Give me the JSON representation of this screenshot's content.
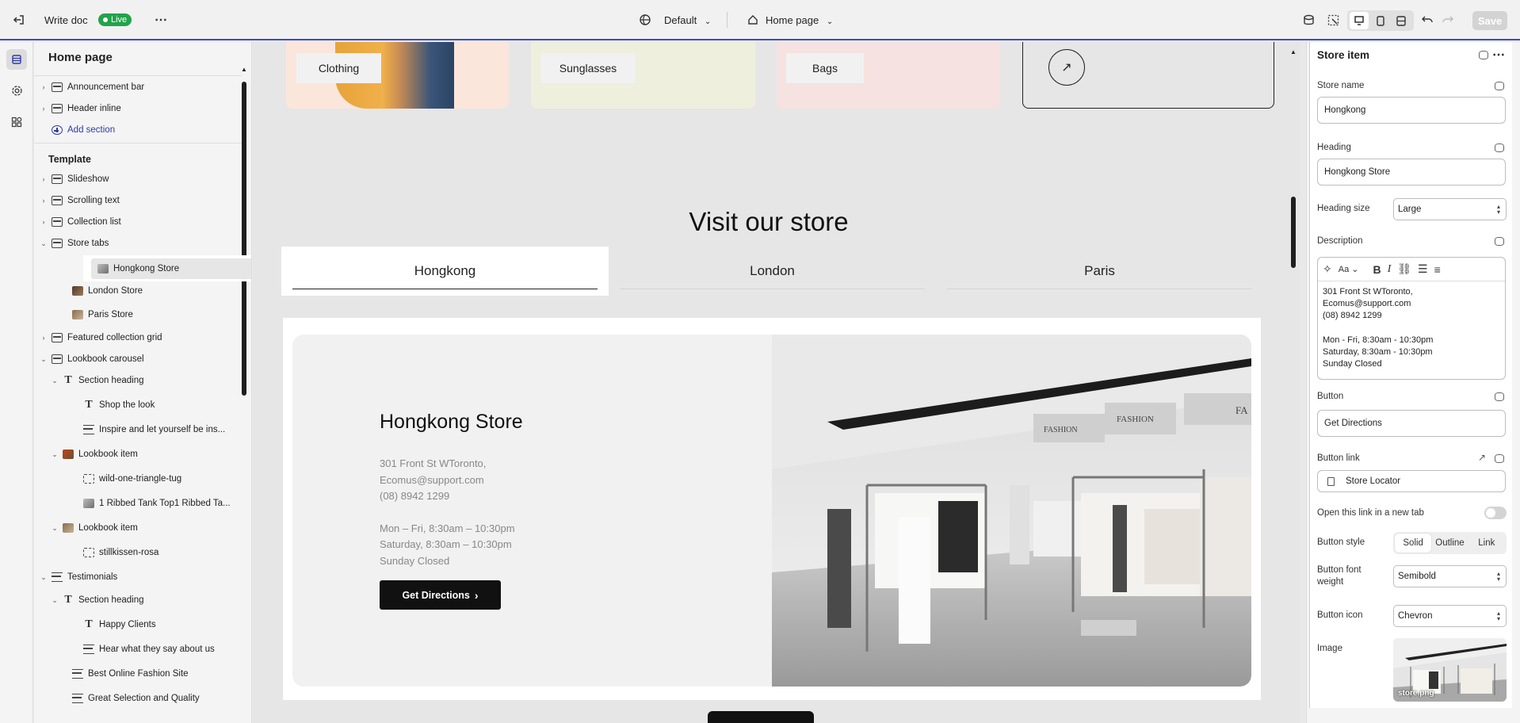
{
  "topbar": {
    "doc_title": "Write doc",
    "status_badge": "Live",
    "theme_label": "Default",
    "page_label": "Home page",
    "save_label": "Save"
  },
  "tree": {
    "title": "Home page",
    "header_items": [
      "Announcement bar",
      "Header inline"
    ],
    "add_section_label": "Add section",
    "template_label": "Template",
    "items": [
      {
        "label": "Slideshow"
      },
      {
        "label": "Scrolling text"
      },
      {
        "label": "Collection list"
      },
      {
        "label": "Store tabs"
      },
      {
        "label": "Hongkong Store"
      },
      {
        "label": "London Store"
      },
      {
        "label": "Paris Store"
      },
      {
        "label": "Featured collection grid"
      },
      {
        "label": "Lookbook carousel"
      },
      {
        "label": "Section heading"
      },
      {
        "label": "Shop the look"
      },
      {
        "label": "Inspire and let yourself be ins..."
      },
      {
        "label": "Lookbook item"
      },
      {
        "label": "wild-one-triangle-tug"
      },
      {
        "label": "1 Ribbed Tank Top1 Ribbed Ta..."
      },
      {
        "label": "Lookbook item"
      },
      {
        "label": "stillkissen-rosa"
      },
      {
        "label": "Testimonials"
      },
      {
        "label": "Section heading"
      },
      {
        "label": "Happy Clients"
      },
      {
        "label": "Hear what they say about us"
      },
      {
        "label": "Best Online Fashion Site"
      },
      {
        "label": "Great Selection and Quality"
      }
    ]
  },
  "canvas": {
    "categories": [
      "Clothing",
      "Sunglasses",
      "Bags"
    ],
    "section_heading": "Visit our store",
    "tabs": [
      "Hongkong",
      "London",
      "Paris"
    ],
    "store": {
      "name": "Hongkong Store",
      "address_lines": [
        "301 Front St WToronto,",
        "Ecomus@support.com",
        "(08) 8942 1299"
      ],
      "hours_lines": [
        "Mon – Fri, 8:30am – 10:30pm",
        "Saturday, 8:30am – 10:30pm",
        "Sunday Closed"
      ],
      "button_label": "Get Directions"
    },
    "photo_signs": [
      "FASHION",
      "FASHION",
      "FA"
    ]
  },
  "panel": {
    "title": "Store item",
    "store_name_label": "Store name",
    "store_name_value": "Hongkong",
    "heading_label": "Heading",
    "heading_value": "Hongkong Store",
    "heading_size_label": "Heading size",
    "heading_size_value": "Large",
    "description_label": "Description",
    "description_lines": [
      "301 Front St WToronto,",
      "Ecomus@support.com",
      "(08) 8942 1299",
      "",
      "Mon - Fri, 8:30am - 10:30pm",
      "Saturday, 8:30am - 10:30pm",
      "Sunday Closed"
    ],
    "button_label": "Button",
    "button_value": "Get Directions",
    "button_link_label": "Button link",
    "button_link_value": "Store Locator",
    "new_tab_label": "Open this link in a new tab",
    "new_tab_enabled": false,
    "button_style_label": "Button style",
    "button_style_options": [
      "Solid",
      "Outline",
      "Link"
    ],
    "button_style_selected": "Solid",
    "button_font_weight_label": "Button font weight",
    "button_font_weight_value": "Semibold",
    "button_icon_label": "Button icon",
    "button_icon_value": "Chevron",
    "image_label": "Image",
    "image_filename": "store.png"
  },
  "colors": {
    "accent": "#2d3aa8",
    "live": "#22a34a",
    "button_dark": "#111111"
  }
}
